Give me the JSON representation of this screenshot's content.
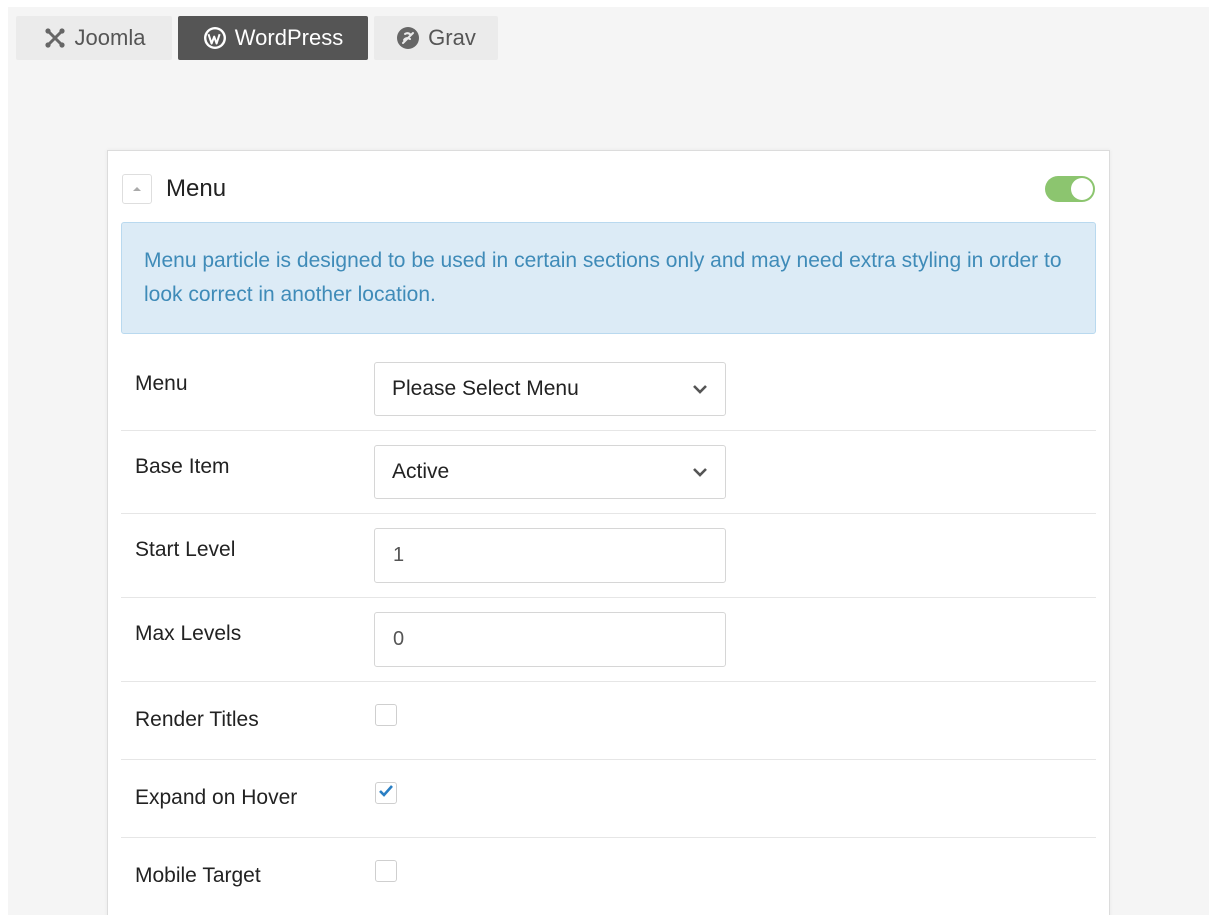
{
  "tabs": [
    {
      "label": "Joomla",
      "icon": "joomla-icon",
      "active": false
    },
    {
      "label": "WordPress",
      "icon": "wordpress-icon",
      "active": true
    },
    {
      "label": "Grav",
      "icon": "grav-icon",
      "active": false
    }
  ],
  "panel": {
    "title": "Menu",
    "enabled": true,
    "notice": "Menu particle is designed to be used in certain sections only and may need extra styling in order to look correct in another location."
  },
  "fields": {
    "menu": {
      "label": "Menu",
      "value": "Please Select Menu"
    },
    "base_item": {
      "label": "Base Item",
      "value": "Active"
    },
    "start_level": {
      "label": "Start Level",
      "value": "1"
    },
    "max_levels": {
      "label": "Max Levels",
      "value": "0"
    },
    "render_titles": {
      "label": "Render Titles",
      "checked": false
    },
    "expand_on_hover": {
      "label": "Expand on Hover",
      "checked": true
    },
    "mobile_target": {
      "label": "Mobile Target",
      "checked": false
    }
  },
  "colors": {
    "active_tab": "#555555",
    "toggle_on": "#8cc56f",
    "notice_bg": "#dcebf6",
    "notice_text": "#3f8bb8",
    "check": "#2a7fc4"
  }
}
